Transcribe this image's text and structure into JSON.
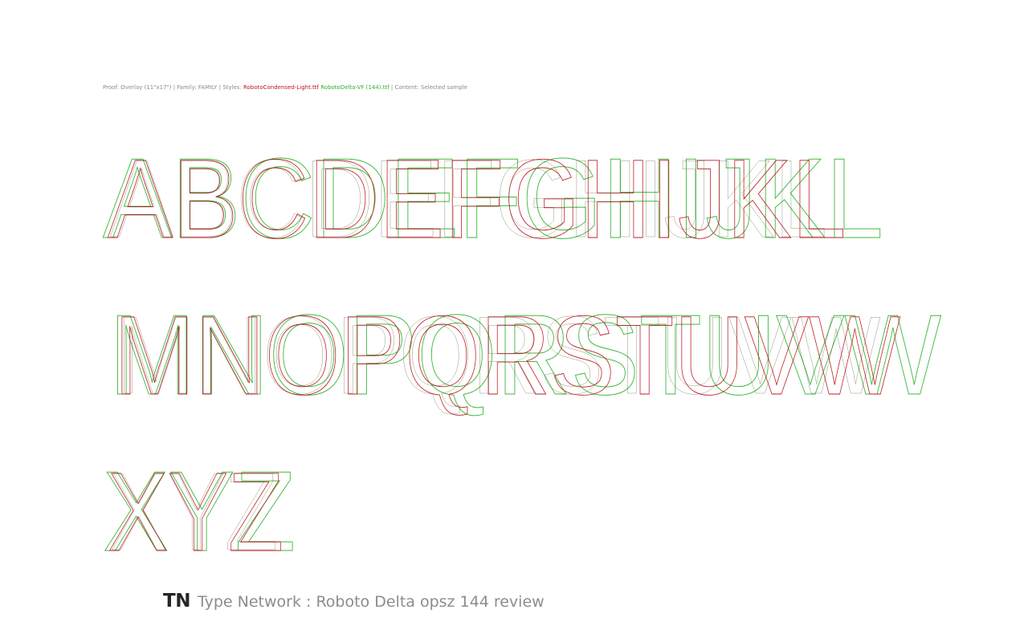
{
  "header": {
    "prefix": "Proof: Overlay (11\"x17\") | Family: FAMILY | Styles: ",
    "style_a": "RobotoCondensed-Light.ttf",
    "style_b": "RobotoDelta-VF (144).ttf",
    "suffix": " | Content: Selected sample"
  },
  "colors": {
    "style_a": "#c0151b",
    "style_b": "#2fb02c",
    "text_gray": "#8a8a8a"
  },
  "sample": {
    "rows": [
      "ABCDEFGHIJKL",
      "MNOPQRSTUVW",
      "XYZ"
    ]
  },
  "footer": {
    "logo": "TN",
    "title": "Type Network : Roboto Delta opsz 144 review"
  }
}
